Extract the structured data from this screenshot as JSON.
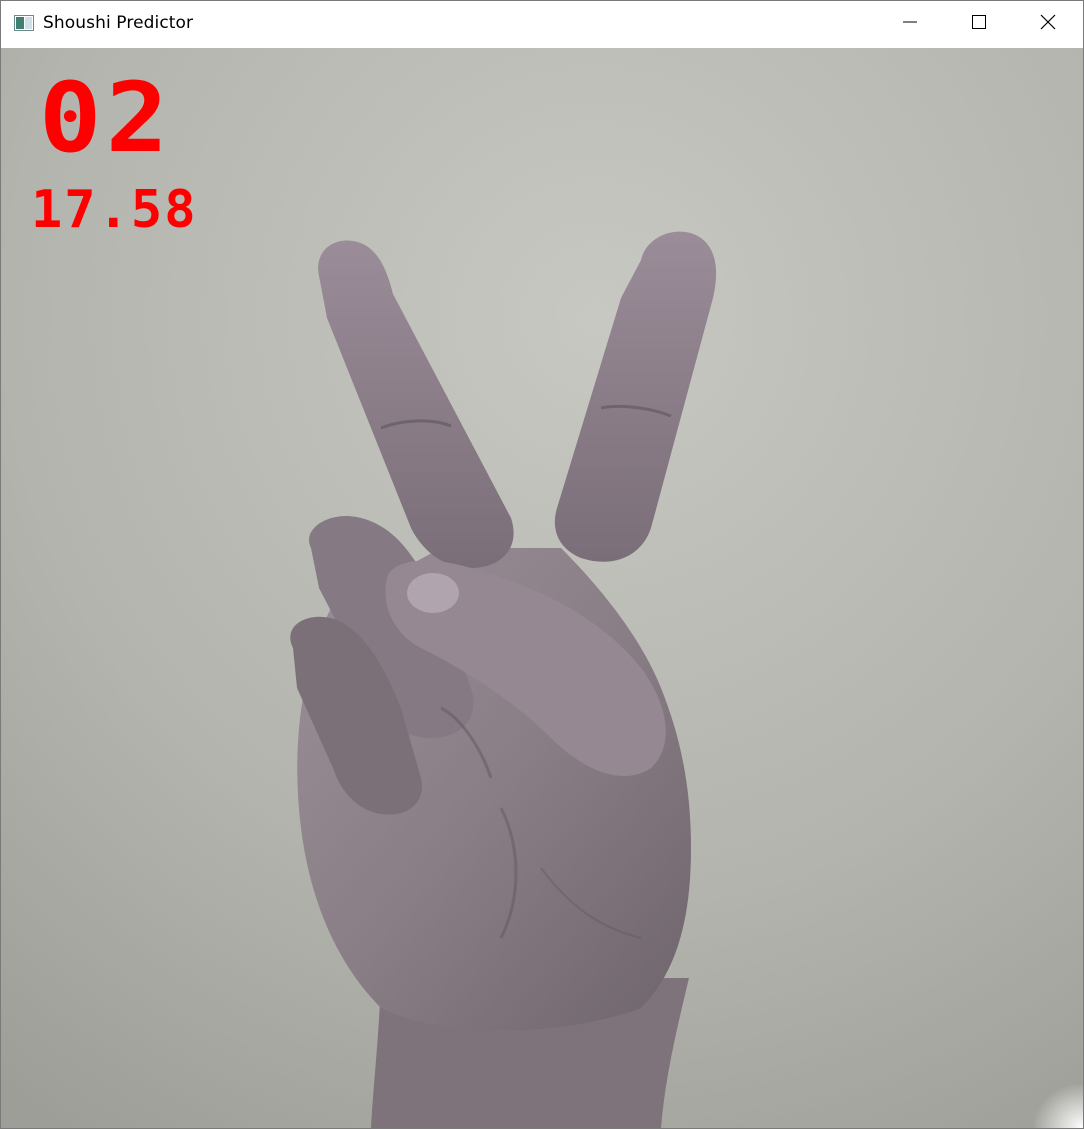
{
  "window": {
    "title": "Shoushi Predictor",
    "icon": "app-window-icon",
    "controls": {
      "minimize_icon": "minimize-icon",
      "maximize_icon": "maximize-icon",
      "close_icon": "close-icon"
    }
  },
  "prediction": {
    "label": "02",
    "score": "17.58",
    "overlay_color": "#ff0000"
  },
  "camera_feed": {
    "content": "hand-gesture-v-sign"
  }
}
